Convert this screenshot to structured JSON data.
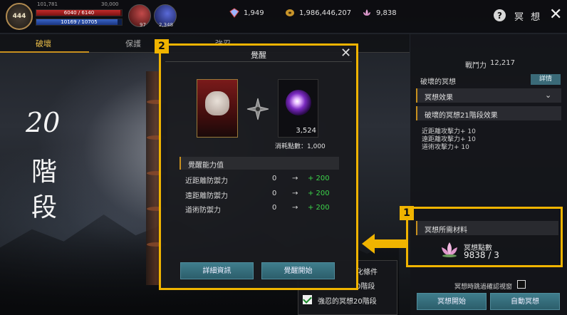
{
  "header": {
    "level": "444",
    "small_stat_left": "101,781",
    "small_stat_right": "30,000",
    "hp": "6040 / 6140",
    "hp_fraction": 0.98,
    "mp": "10169 / 10705",
    "mp_fraction": 0.95,
    "skill1_count": "97",
    "skill2_count": "2,348",
    "gem_amount": "1,949",
    "coin_amount": "1,986,446,207",
    "lotus_amount": "9,838",
    "title": "冥 想",
    "help_icon": "?",
    "close_icon": "✕"
  },
  "tabs": [
    {
      "label": "破壞",
      "active": true
    },
    {
      "label": "保護",
      "active": false
    },
    {
      "label": "強忍",
      "active": false
    }
  ],
  "stage": {
    "number": "20",
    "char1": "階",
    "char2": "段"
  },
  "right_panel": {
    "power_label": "戰鬥力",
    "power_value": "12,217",
    "section_title": "破壞的冥想",
    "detail_button": "詳情",
    "effect_header": "冥想效果",
    "stage_effect_header": "破壞的冥想21階段效果",
    "effects": [
      "近距離攻擊力+ 10",
      "遠距離攻擊力+ 10",
      "道術攻擊力+ 10"
    ],
    "material_header": "冥想所需材料",
    "material_name": "冥想點數",
    "material_count": "9838 / 3",
    "skip_label": "冥想時跳過確認視窗",
    "start_button": "冥想開始",
    "auto_button": "自動冥想"
  },
  "markers": {
    "one": "1",
    "two": "2"
  },
  "conditions": {
    "line1": "化條件",
    "line2": "0階段",
    "line3": "強忍的冥想20階段"
  },
  "dialog": {
    "title": "覺醒",
    "close_icon": "✕",
    "points_value": "3,524",
    "consume_label": "消耗點數：1,000",
    "ability_header": "覺醒能力值",
    "abilities": [
      {
        "name": "近距離防禦力",
        "from": "0",
        "arrow": "→",
        "to": "+ 200"
      },
      {
        "name": "遠距離防禦力",
        "from": "0",
        "arrow": "→",
        "to": "+ 200"
      },
      {
        "name": "道術防禦力",
        "from": "0",
        "arrow": "→",
        "to": "+ 200"
      }
    ],
    "detail_button": "詳細資訊",
    "start_button": "覺醒開始"
  },
  "colors": {
    "highlight": "#f0b400",
    "accent_gold": "#c8901e",
    "teal_button": "#3f7d8c",
    "positive_green": "#3cd34a"
  }
}
